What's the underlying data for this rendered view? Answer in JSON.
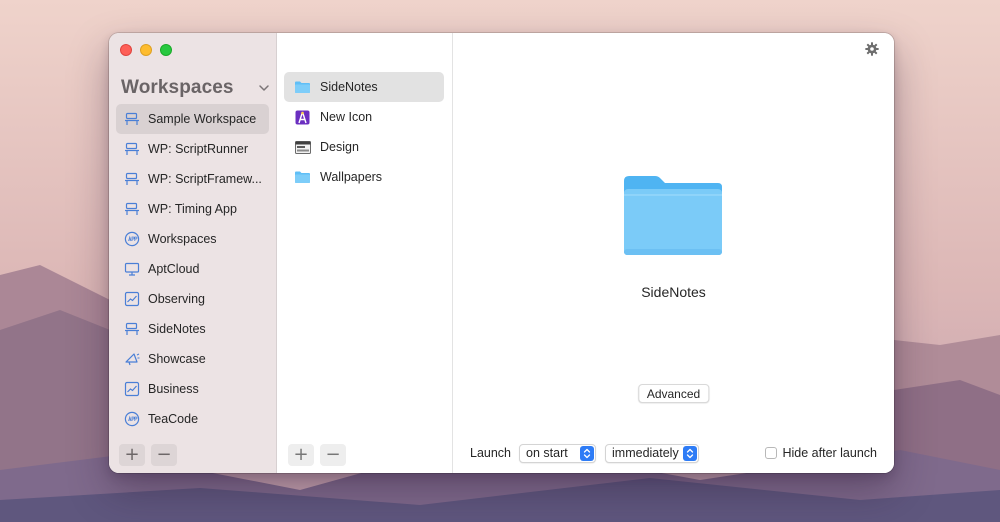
{
  "window": {
    "traffic_lights": [
      "close",
      "minimize",
      "zoom"
    ]
  },
  "sidebar": {
    "title": "Workspaces",
    "items": [
      {
        "label": "Sample Workspace",
        "icon": "workspace-icon",
        "selected": true
      },
      {
        "label": "WP: ScriptRunner",
        "icon": "workspace-icon",
        "selected": false
      },
      {
        "label": "WP: ScriptFramew...",
        "icon": "workspace-icon",
        "selected": false
      },
      {
        "label": "WP: Timing App",
        "icon": "workspace-icon",
        "selected": false
      },
      {
        "label": "Workspaces",
        "icon": "app-icon",
        "selected": false
      },
      {
        "label": "AptCloud",
        "icon": "monitor-icon",
        "selected": false
      },
      {
        "label": "Observing",
        "icon": "chart-icon",
        "selected": false
      },
      {
        "label": "SideNotes",
        "icon": "workspace-icon",
        "selected": false
      },
      {
        "label": "Showcase",
        "icon": "megaphone-icon",
        "selected": false
      },
      {
        "label": "Business",
        "icon": "chart-icon",
        "selected": false
      },
      {
        "label": "TeaCode",
        "icon": "app-icon",
        "selected": false
      }
    ],
    "add_label": "+",
    "remove_label": "−"
  },
  "items_list": {
    "items": [
      {
        "label": "SideNotes",
        "icon": "folder-icon",
        "selected": true
      },
      {
        "label": "New Icon",
        "icon": "design-app-icon",
        "selected": false
      },
      {
        "label": "Design",
        "icon": "window-icon",
        "selected": false
      },
      {
        "label": "Wallpapers",
        "icon": "folder-icon",
        "selected": false
      }
    ],
    "add_label": "+",
    "remove_label": "−"
  },
  "detail": {
    "name": "SideNotes",
    "advanced_label": "Advanced",
    "launch_label": "Launch",
    "launch_when": "on start",
    "launch_timing": "immediately",
    "hide_after_launch_label": "Hide after launch",
    "hide_after_launch_checked": false
  },
  "colors": {
    "accent": "#2e7cf6",
    "folder": "#5fbff7",
    "sidebar_icon": "#4a7fd6"
  }
}
